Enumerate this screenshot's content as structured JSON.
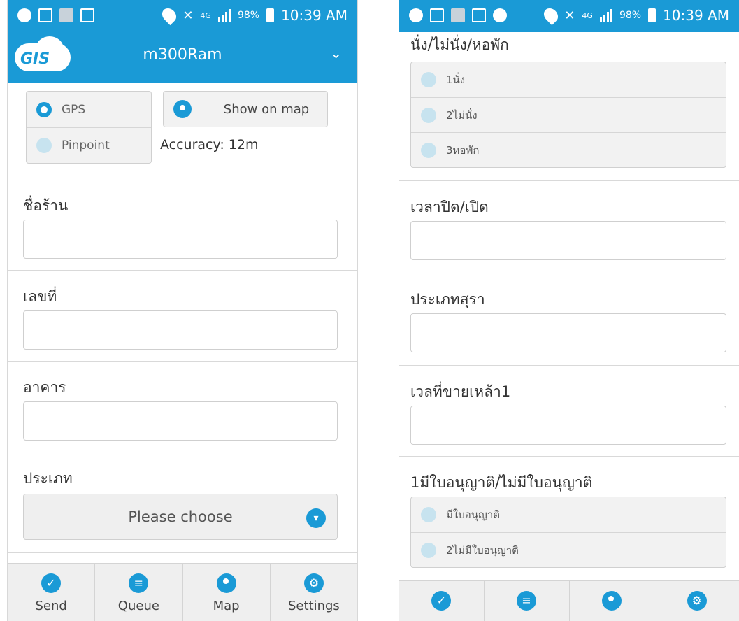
{
  "statusbar": {
    "network": "4G",
    "battery": "98%",
    "time": "10:39 AM"
  },
  "appbar": {
    "logo_text": "GIS",
    "title": "m300Ram"
  },
  "location": {
    "options": [
      "GPS",
      "Pinpoint"
    ],
    "selected": "GPS",
    "show_on_map": "Show on map",
    "accuracy": "Accuracy: 12m"
  },
  "left_form": {
    "field1_label": "ชื่อร้าน",
    "field2_label": "เลขที่",
    "field3_label": "อาคาร",
    "field4_label": "ประเภท",
    "select_value": "Please choose"
  },
  "tabs": [
    "Send",
    "Queue",
    "Map",
    "Settings"
  ],
  "right_form": {
    "group1_label": "นั่ง/ไม่นั่ง/หอพัก",
    "group1_options": [
      "1นั่ง",
      "2ไม่นั่ง",
      "3หอพัก"
    ],
    "field_a_label": "เวลาปิด/เปิด",
    "field_b_label": "ประเภทสุรา",
    "field_c_label": "เวลที่ขายเหล้า1",
    "group2_label": "1มีใบอนุญาติ/ไม่มีใบอนุญาติ",
    "group2_options": [
      "มีใบอนุญาติ",
      "2ไม่มีใบอนุญาติ"
    ]
  },
  "colors": {
    "accent": "#1a9ad6",
    "panel": "#f2f2f2"
  }
}
